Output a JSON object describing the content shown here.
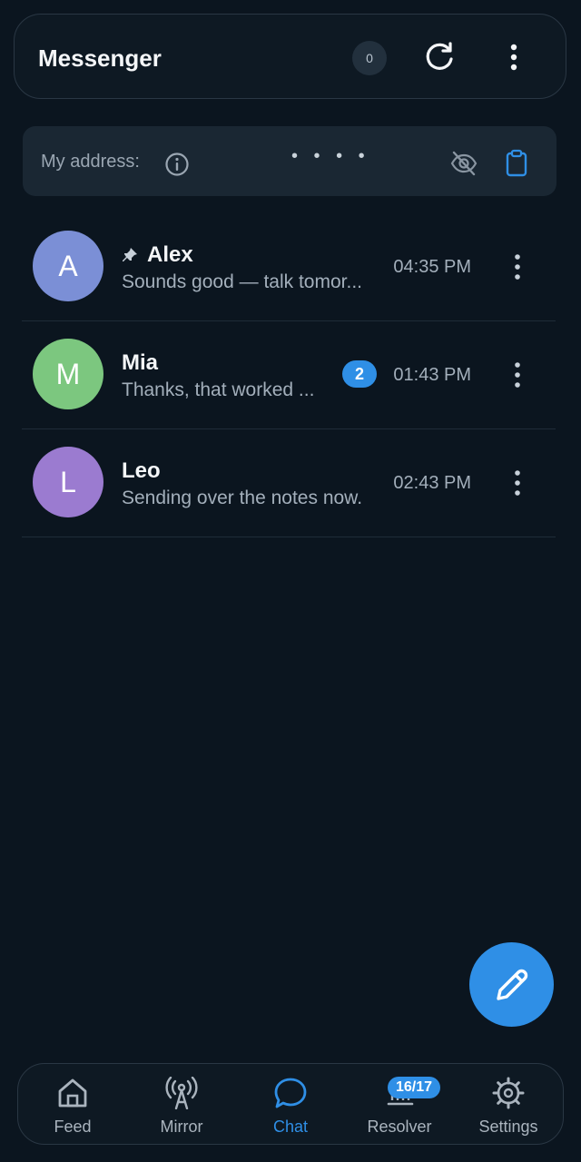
{
  "header": {
    "title": "Messenger",
    "count": "0",
    "refresh_icon": "refresh-icon",
    "more_icon": "more-vertical-icon"
  },
  "address": {
    "label": "My address:",
    "value_masked": "• • • •",
    "info_icon": "info-icon",
    "hide_icon": "eye-off-icon",
    "copy_icon": "clipboard-icon"
  },
  "chats": [
    {
      "initial": "A",
      "name": "Alex",
      "pinned": true,
      "preview": "Sounds good — talk tomor...",
      "time": "04:35 PM",
      "unread": "",
      "avatar_color": "#7b8fd6"
    },
    {
      "initial": "M",
      "name": "Mia",
      "pinned": false,
      "preview": "Thanks, that worked ...",
      "time": "01:43 PM",
      "unread": "2",
      "avatar_color": "#7cc77f"
    },
    {
      "initial": "L",
      "name": "Leo",
      "pinned": false,
      "preview": "Sending over the notes now.",
      "time": "02:43 PM",
      "unread": "",
      "avatar_color": "#9b7bd0"
    }
  ],
  "fab": {
    "icon": "pencil-icon"
  },
  "nav": [
    {
      "label": "Feed",
      "icon": "home-icon",
      "active": false
    },
    {
      "label": "Mirror",
      "icon": "antenna-icon",
      "active": false
    },
    {
      "label": "Chat",
      "icon": "chat-bubble-icon",
      "active": true
    },
    {
      "label": "Resolver",
      "icon": "resolver-icon",
      "active": false,
      "badge": "16/17"
    },
    {
      "label": "Settings",
      "icon": "gear-icon",
      "active": false
    }
  ],
  "colors": {
    "accent": "#2f8fe6",
    "background": "#0b151f"
  }
}
